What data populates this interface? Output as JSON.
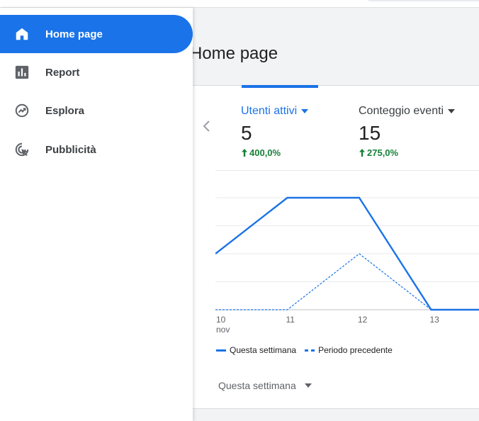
{
  "sidebar": {
    "items": [
      {
        "label": "Home page",
        "icon": "home-icon",
        "active": true
      },
      {
        "label": "Report",
        "icon": "bar-chart-icon",
        "active": false
      },
      {
        "label": "Esplora",
        "icon": "explore-icon",
        "active": false
      },
      {
        "label": "Pubblicità",
        "icon": "advertising-icon",
        "active": false
      }
    ]
  },
  "main": {
    "title": "Home page",
    "metrics": [
      {
        "label": "Utenti attivi",
        "value": "5",
        "change": "400,0%",
        "selected": true
      },
      {
        "label": "Conteggio eventi",
        "value": "15",
        "change": "275,0%",
        "selected": false
      }
    ],
    "period_select": "Questa settimana"
  },
  "colors": {
    "accent": "#1a73e8",
    "positive": "#188038"
  },
  "chart_data": {
    "type": "line",
    "x": [
      "10\nnov",
      "11",
      "12",
      "13"
    ],
    "x_tick_labels": [
      [
        "10",
        "nov"
      ],
      [
        "11"
      ],
      [
        "12"
      ],
      [
        "13"
      ]
    ],
    "series": [
      {
        "name": "Questa settimana",
        "style": "solid",
        "values": [
          4,
          8,
          8,
          0,
          0
        ]
      },
      {
        "name": "Periodo precedente",
        "style": "dashed",
        "values": [
          0,
          0,
          4,
          0,
          0
        ]
      }
    ],
    "ylim": [
      0,
      8
    ],
    "grid": true,
    "legend": "bottom-left"
  }
}
